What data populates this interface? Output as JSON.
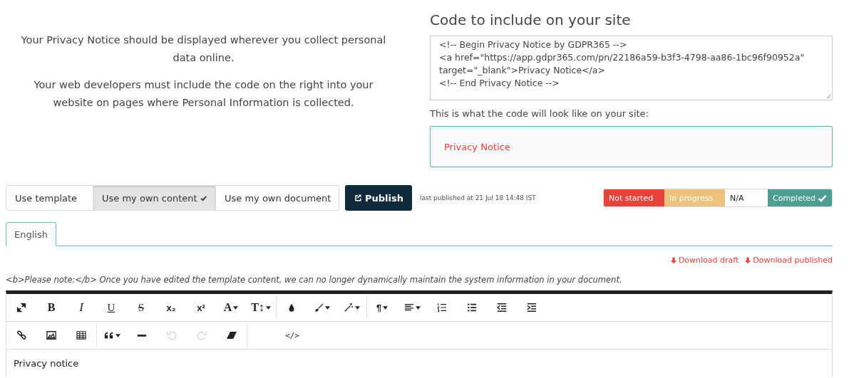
{
  "intro": {
    "paragraphs": [
      "Your Privacy Notice should be displayed wherever you collect personal data online.",
      "Your web developers must include the code on the right into your website on pages where Personal Information is collected."
    ]
  },
  "embed": {
    "title": "Code to include on your site",
    "code_lines": [
      "<!-- Begin Privacy Notice by GDPR365 -->",
      "<a href=\"https://app.gdpr365.com/pn/22186a59-b3f3-4798-aa86-1bc96f90952a\" target=\"_blank\">Privacy Notice</a>",
      "<!-- End Privacy Notice -->"
    ],
    "preview_caption": "This is what the code will look like on your site:",
    "preview_link": "Privacy Notice"
  },
  "content_source": [
    {
      "label": "Use template",
      "selected": false
    },
    {
      "label": "Use my own content",
      "selected": true
    },
    {
      "label": "Use my own document",
      "selected": false
    }
  ],
  "publish": {
    "label": "Publish",
    "last_published": "last published at 21 Jul 18 14:48 IST"
  },
  "status": [
    {
      "label": "Not started",
      "color": "#e8423a",
      "selected": false
    },
    {
      "label": "In progress",
      "color": "#edc27a",
      "selected": false
    },
    {
      "label": "N/A",
      "color": "#ffffff",
      "selected": false
    },
    {
      "label": "Completed",
      "color": "#4e9e94",
      "selected": true
    }
  ],
  "tabs": [
    {
      "label": "English",
      "selected": true
    }
  ],
  "downloads": [
    "Download draft",
    "Download published"
  ],
  "note": "<b>Please note:</b> Once you have edited the template content, we can no longer dynamically maintain the system information in your document.",
  "toolbar": [
    [
      [
        {
          "kind": "expand",
          "caret": false,
          "disabled": false
        },
        {
          "kind": "bold",
          "label": "B",
          "caret": false,
          "disabled": false
        },
        {
          "kind": "italic",
          "label": "I",
          "caret": false,
          "disabled": false
        },
        {
          "kind": "underline",
          "label": "U",
          "caret": false,
          "disabled": false
        },
        {
          "kind": "strike",
          "label": "S",
          "caret": false,
          "disabled": false
        },
        {
          "kind": "plain",
          "label": "x₂",
          "caret": false,
          "disabled": false
        },
        {
          "kind": "plain",
          "label": "x²",
          "caret": false,
          "disabled": false
        },
        {
          "kind": "serif",
          "label": "A",
          "caret": true,
          "disabled": false
        },
        {
          "kind": "serif",
          "label": "T↕",
          "caret": true,
          "disabled": false
        }
      ],
      [
        {
          "kind": "drop",
          "caret": false,
          "disabled": false
        },
        {
          "kind": "brush",
          "caret": true,
          "disabled": false
        },
        {
          "kind": "wand",
          "caret": true,
          "disabled": false
        }
      ],
      [
        {
          "kind": "plain",
          "label": "¶",
          "caret": true,
          "disabled": false
        },
        {
          "kind": "align",
          "caret": true,
          "disabled": false
        },
        {
          "kind": "ol",
          "caret": false,
          "disabled": false
        },
        {
          "kind": "ul",
          "caret": false,
          "disabled": false
        },
        {
          "kind": "outdent",
          "caret": false,
          "disabled": false
        },
        {
          "kind": "indent",
          "caret": false,
          "disabled": false
        }
      ]
    ],
    [
      [
        {
          "kind": "link",
          "caret": false,
          "disabled": false
        },
        {
          "kind": "image",
          "caret": false,
          "disabled": false
        },
        {
          "kind": "table",
          "caret": false,
          "disabled": false
        }
      ],
      [
        {
          "kind": "quote",
          "caret": true,
          "disabled": false
        },
        {
          "kind": "hr",
          "caret": false,
          "disabled": false
        },
        {
          "kind": "undo",
          "caret": false,
          "disabled": true
        },
        {
          "kind": "redo",
          "caret": false,
          "disabled": true
        },
        {
          "kind": "eraser",
          "caret": false,
          "disabled": false
        }
      ],
      [
        {
          "kind": "mono",
          "label": "</>",
          "caret": false,
          "disabled": false
        }
      ]
    ]
  ],
  "editor_text": "Privacy notice"
}
